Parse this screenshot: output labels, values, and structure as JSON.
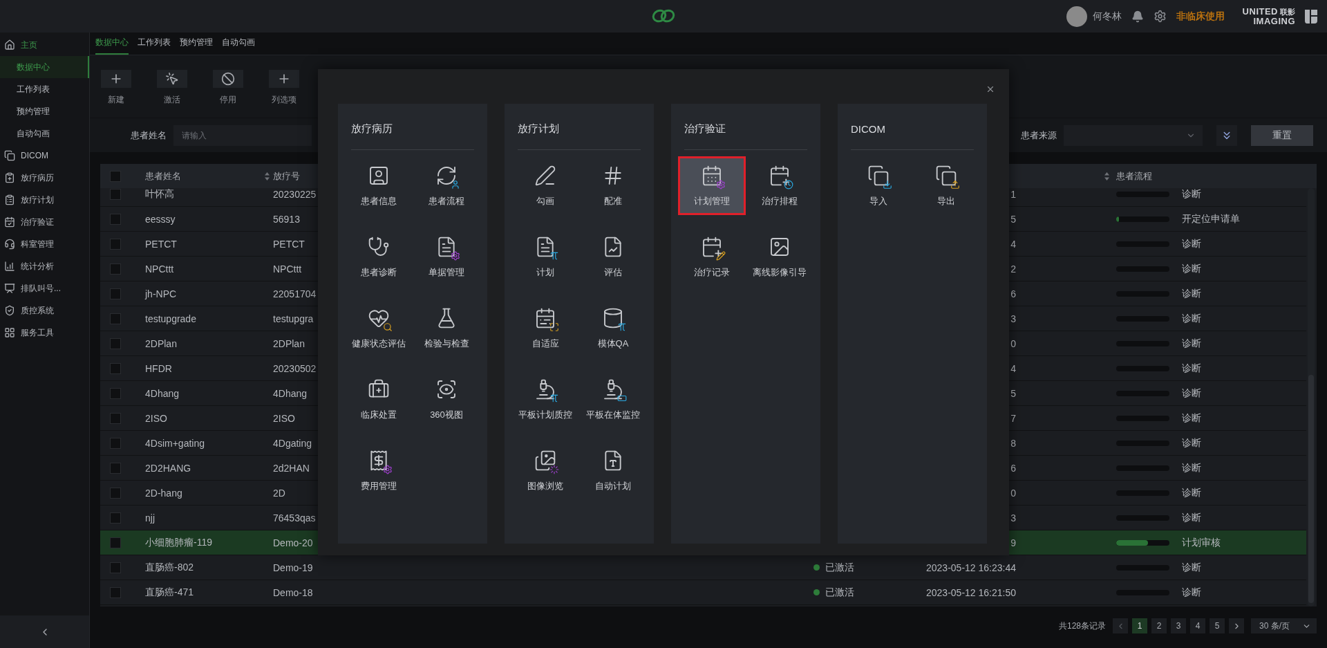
{
  "top_bar": {
    "user": "何冬林",
    "mode": "非临床使用",
    "brand": {
      "latin_top": "UNITED",
      "chinese": "联影",
      "latin_bottom": "IMAGING"
    }
  },
  "sidebar": {
    "items": [
      {
        "label": "主页",
        "selected": true,
        "children": [
          {
            "label": "数据中心",
            "selected": true
          },
          {
            "label": "工作列表",
            "selected": false
          },
          {
            "label": "预约管理",
            "selected": false
          },
          {
            "label": "自动勾画",
            "selected": false
          }
        ]
      },
      {
        "label": "DICOM",
        "selected": false
      },
      {
        "label": "放疗病历",
        "selected": false
      },
      {
        "label": "放疗计划",
        "selected": false
      },
      {
        "label": "治疗验证",
        "selected": false
      },
      {
        "label": "科室管理",
        "selected": false
      },
      {
        "label": "统计分析",
        "selected": false
      },
      {
        "label": "排队叫号...",
        "selected": false
      },
      {
        "label": "质控系统",
        "selected": false
      },
      {
        "label": "服务工具",
        "selected": false
      }
    ]
  },
  "tabs": [
    {
      "label": "数据中心",
      "selected": true
    },
    {
      "label": "工作列表",
      "selected": false
    },
    {
      "label": "预约管理",
      "selected": false
    },
    {
      "label": "自动勾画",
      "selected": false
    }
  ],
  "toolbar": [
    {
      "label": "新建"
    },
    {
      "label": "激活"
    },
    {
      "label": "停用"
    },
    {
      "label": "列选项"
    }
  ],
  "filters": {
    "patient_name": {
      "label": "患者姓名",
      "placeholder": "请输入"
    },
    "patient_source": {
      "label": "患者来源"
    },
    "reset": "重置"
  },
  "table": {
    "all_checked": false,
    "columns": [
      {
        "label": "患者姓名"
      },
      {
        "label": "放疗号"
      },
      {
        "label": "患者流程"
      }
    ],
    "rows": [
      {
        "name": "叶怀高",
        "rt_no": "20230225",
        "time": "1",
        "level": 0,
        "process": "诊断",
        "selected": false
      },
      {
        "name": "eesssy",
        "rt_no": "56913",
        "time": "5",
        "level": 0.05,
        "process": "开定位申请单",
        "selected": false
      },
      {
        "name": "PETCT",
        "rt_no": "PETCT",
        "time": "4",
        "level": 0,
        "process": "诊断",
        "selected": false
      },
      {
        "name": "NPCttt",
        "rt_no": "NPCttt",
        "time": "2",
        "level": 0,
        "process": "诊断",
        "selected": false
      },
      {
        "name": "jh-NPC",
        "rt_no": "22051704",
        "time": "6",
        "level": 0,
        "process": "诊断",
        "selected": false
      },
      {
        "name": "testupgrade",
        "rt_no": "testupgra",
        "time": "3",
        "level": 0,
        "process": "诊断",
        "selected": false
      },
      {
        "name": "2DPlan",
        "rt_no": "2DPlan",
        "time": "0",
        "level": 0,
        "process": "诊断",
        "selected": false
      },
      {
        "name": "HFDR",
        "rt_no": "20230502",
        "time": "4",
        "level": 0,
        "process": "诊断",
        "selected": false
      },
      {
        "name": "4Dhang",
        "rt_no": "4Dhang",
        "time": "5",
        "level": 0,
        "process": "诊断",
        "selected": false
      },
      {
        "name": "2ISO",
        "rt_no": "2ISO",
        "time": "7",
        "level": 0,
        "process": "诊断",
        "selected": false
      },
      {
        "name": "4Dsim+gating",
        "rt_no": "4Dgating",
        "time": "8",
        "level": 0,
        "process": "诊断",
        "selected": false
      },
      {
        "name": "2D2HANG",
        "rt_no": "2d2HAN",
        "time": "6",
        "level": 0,
        "process": "诊断",
        "selected": false
      },
      {
        "name": "2D-hang",
        "rt_no": "2D",
        "time": "0",
        "level": 0,
        "process": "诊断",
        "selected": false
      },
      {
        "name": "njj",
        "rt_no": "76453qas",
        "time": "3",
        "level": 0,
        "process": "诊断",
        "selected": false
      },
      {
        "name": "小细胞肺瘤-119",
        "rt_no": "Demo-20",
        "time": "9",
        "level": 0.6,
        "process": "计划审核",
        "selected": true
      },
      {
        "name": "直肠癌-802",
        "rt_no": "Demo-19",
        "status": "已激活",
        "time": "2023-05-12 16:23:44",
        "level": 0,
        "process": "诊断",
        "selected": false
      },
      {
        "name": "直肠癌-471",
        "rt_no": "Demo-18",
        "status": "已激活",
        "time": "2023-05-12 16:21:50",
        "level": 0,
        "process": "诊断",
        "selected": false
      }
    ]
  },
  "pagination": {
    "total": "共128条记录",
    "pages": [
      {
        "label": "1",
        "selected": true
      },
      {
        "label": "2",
        "selected": false
      },
      {
        "label": "3",
        "selected": false
      },
      {
        "label": "4",
        "selected": false
      },
      {
        "label": "5",
        "selected": false
      }
    ],
    "page_size": "30 条/页"
  },
  "dialog": {
    "groups": [
      {
        "title": "放疗病历",
        "items": [
          {
            "label": "患者信息",
            "selected": false
          },
          {
            "label": "患者流程",
            "selected": false
          },
          {
            "label": "患者诊断",
            "selected": false
          },
          {
            "label": "单据管理",
            "selected": false
          },
          {
            "label": "健康状态评估",
            "selected": false
          },
          {
            "label": "检验与检查",
            "selected": false
          },
          {
            "label": "临床处置",
            "selected": false
          },
          {
            "label": "360视图",
            "selected": false
          },
          {
            "label": "费用管理",
            "selected": false
          }
        ]
      },
      {
        "title": "放疗计划",
        "items": [
          {
            "label": "勾画",
            "selected": false
          },
          {
            "label": "配准",
            "selected": false
          },
          {
            "label": "计划",
            "selected": false
          },
          {
            "label": "评估",
            "selected": false
          },
          {
            "label": "自适应",
            "selected": false
          },
          {
            "label": "模体QA",
            "selected": false
          },
          {
            "label": "平板计划质控",
            "selected": false
          },
          {
            "label": "平板在体监控",
            "selected": false
          },
          {
            "label": "图像浏览",
            "selected": false
          },
          {
            "label": "自动计划",
            "selected": false
          }
        ]
      },
      {
        "title": "治疗验证",
        "items": [
          {
            "label": "计划管理",
            "selected": true
          },
          {
            "label": "治疗排程",
            "selected": false
          },
          {
            "label": "治疗记录",
            "selected": false
          },
          {
            "label": "离线影像引导",
            "selected": false
          }
        ]
      },
      {
        "title": "DICOM",
        "items": [
          {
            "label": "导入",
            "selected": false
          },
          {
            "label": "导出",
            "selected": false
          }
        ]
      }
    ]
  }
}
